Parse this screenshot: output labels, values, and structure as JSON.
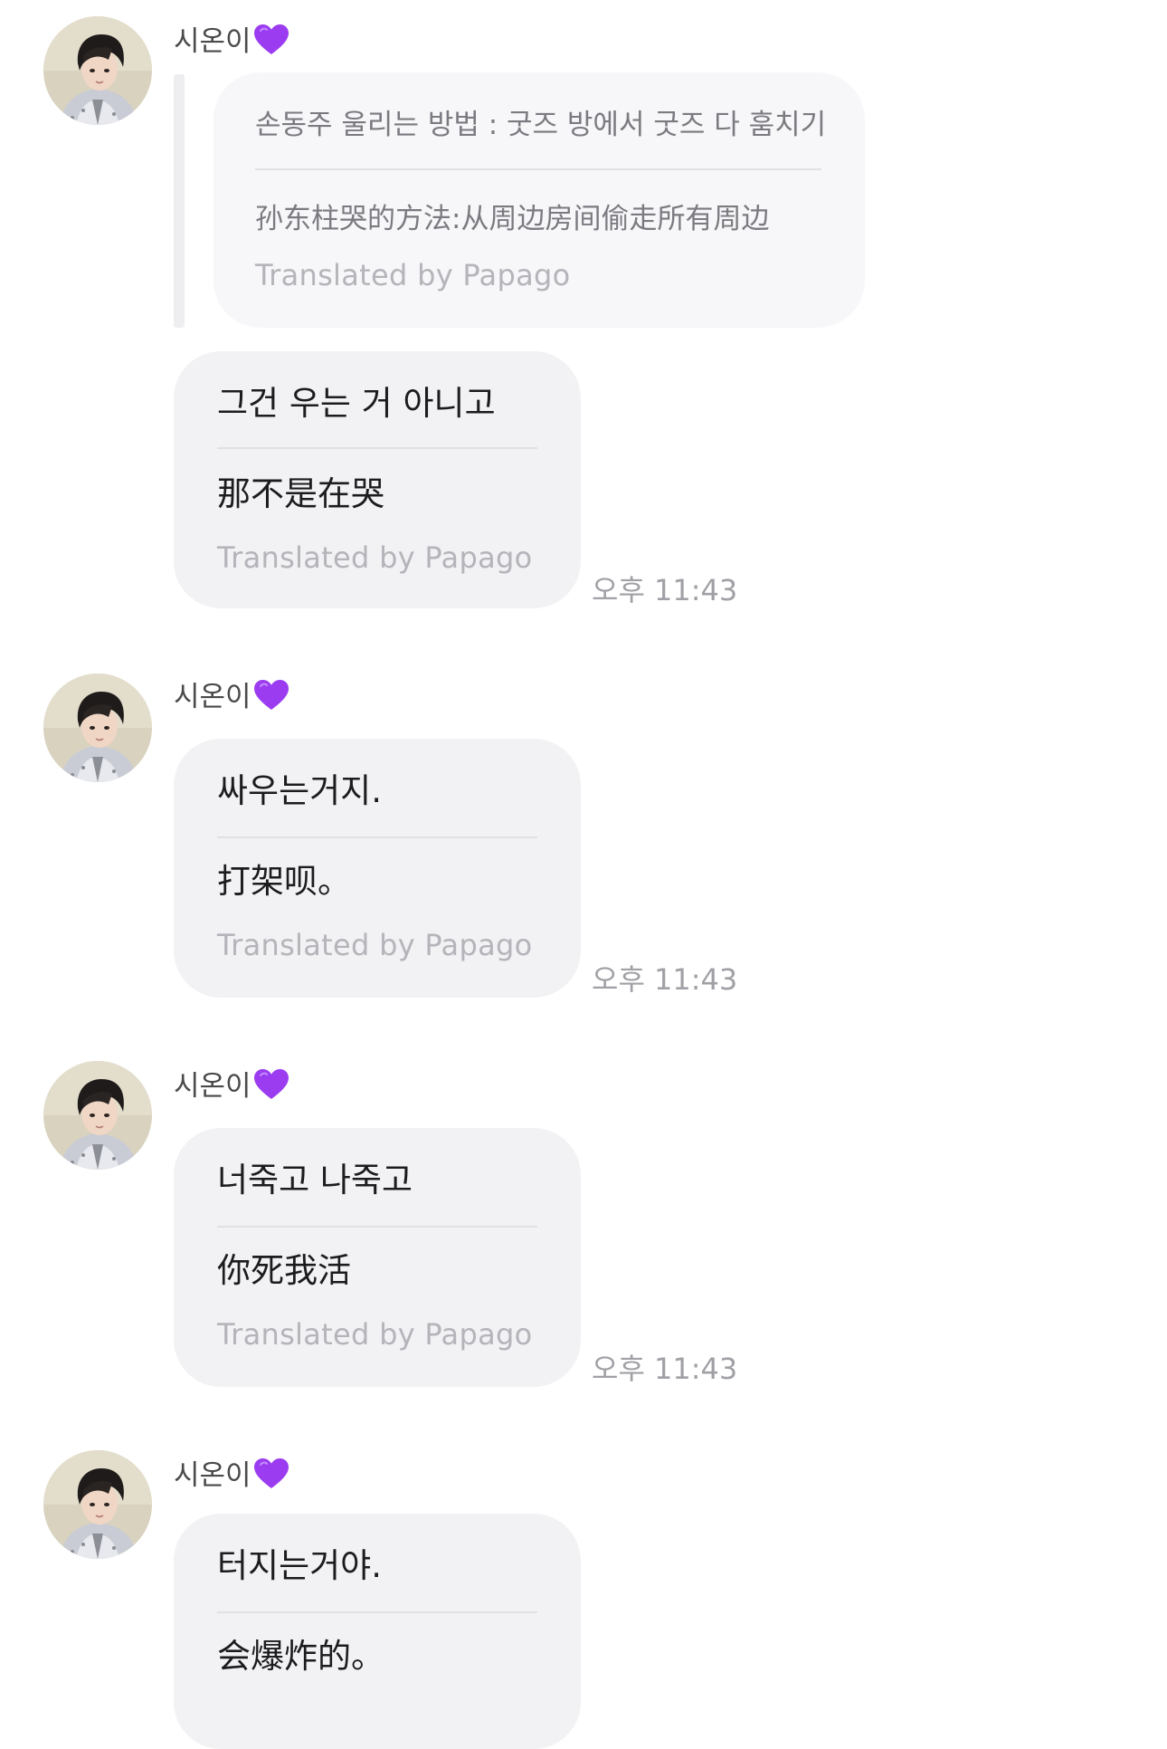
{
  "accent_heart_color": "#9b3cf0",
  "messages": [
    {
      "sender": "시온이",
      "sender_icon": "purple-heart-icon",
      "quoted": {
        "original": "손동주 울리는 방법 : 굿즈 방에서 굿즈 다 훔치기",
        "translation": "孙东柱哭的方法:从周边房间偷走所有周边",
        "credit": "Translated by Papago"
      },
      "original": "그건 우는 거 아니고",
      "translation": "那不是在哭",
      "credit": "Translated by Papago",
      "time": "오후 11:43"
    },
    {
      "sender": "시온이",
      "sender_icon": "purple-heart-icon",
      "original": "싸우는거지.",
      "translation": "打架呗。",
      "credit": "Translated by Papago",
      "time": "오후 11:43"
    },
    {
      "sender": "시온이",
      "sender_icon": "purple-heart-icon",
      "original": "너죽고 나죽고",
      "translation": "你死我活",
      "credit": "Translated by Papago",
      "time": "오후 11:43"
    },
    {
      "sender": "시온이",
      "sender_icon": "purple-heart-icon",
      "original": "터지는거야.",
      "translation": "会爆炸的。"
    }
  ]
}
